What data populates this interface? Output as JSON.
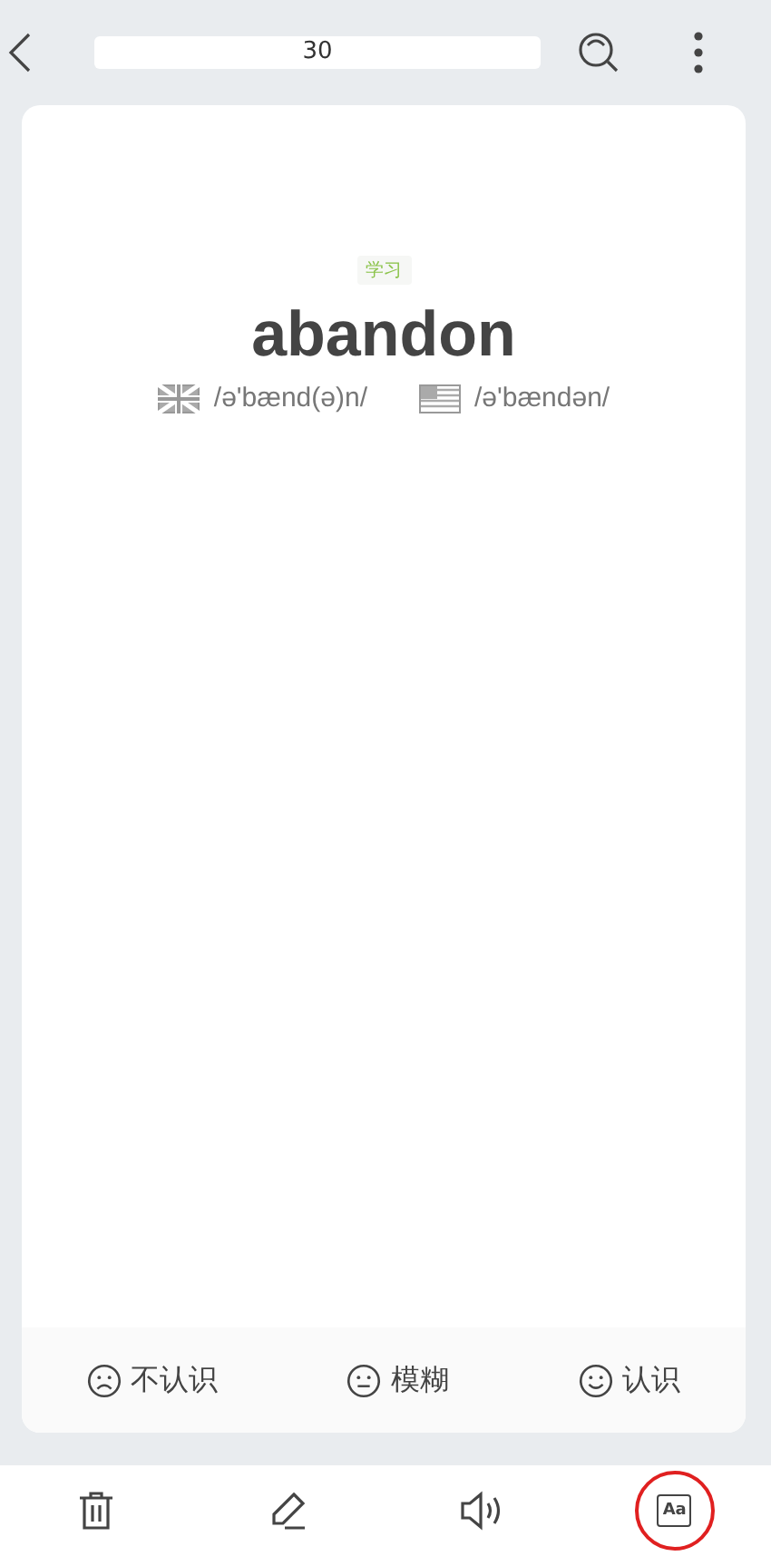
{
  "header": {
    "counter": "30"
  },
  "card": {
    "tag": "学习",
    "word": "abandon",
    "pronunciations": [
      {
        "kind": "uk",
        "text": "/ə'bænd(ə)n/"
      },
      {
        "kind": "us",
        "text": "/ə'bændən/"
      }
    ]
  },
  "ratings": [
    {
      "kind": "sad",
      "label": "不认识"
    },
    {
      "kind": "neutral",
      "label": "模糊"
    },
    {
      "kind": "happy",
      "label": "认识"
    }
  ],
  "toolbar": [
    {
      "kind": "delete",
      "selected": false
    },
    {
      "kind": "edit",
      "selected": false
    },
    {
      "kind": "sound",
      "selected": false
    },
    {
      "kind": "font",
      "label": "Aa",
      "selected": true
    }
  ]
}
